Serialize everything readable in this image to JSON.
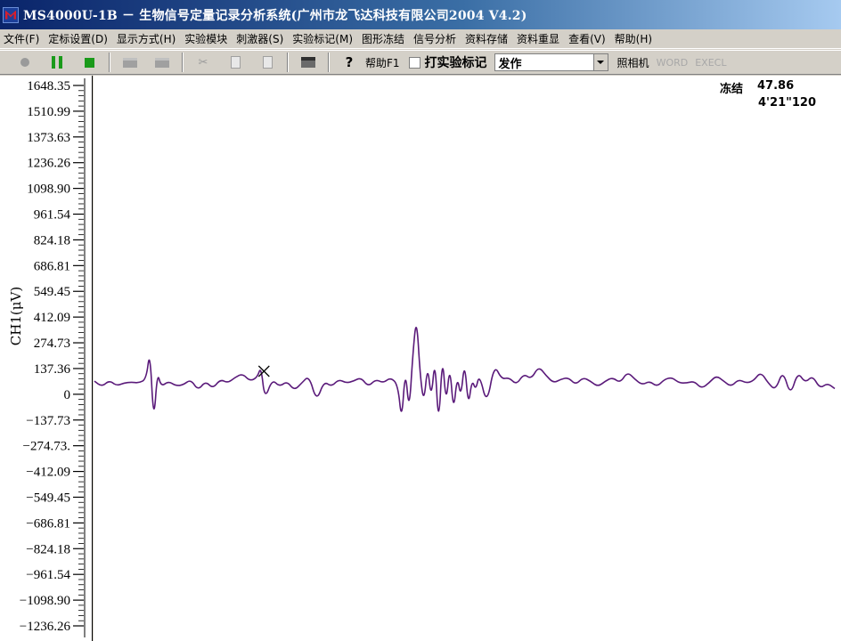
{
  "window": {
    "title": "MS4000U-1B － 生物信号定量记录分析系统(广州市龙飞达科技有限公司2004  V4.2)"
  },
  "menu": [
    "文件(F)",
    "定标设置(D)",
    "显示方式(H)",
    "实验模块",
    "刺激器(S)",
    "实验标记(M)",
    "图形冻结",
    "信号分析",
    "资料存储",
    "资料重显",
    "查看(V)",
    "帮助(H)"
  ],
  "toolbar": {
    "help_label": "帮助F1",
    "mark_label": "打实验标记",
    "event_value": "发作",
    "camera_label": "照相机",
    "word_label": "WORD",
    "excel_label": "EXECL"
  },
  "freeze": {
    "label": "冻结",
    "value": "47.86",
    "time": "4'21\"120"
  },
  "chart_data": {
    "type": "line",
    "title": "",
    "xlabel": "",
    "ylabel": "CH1(μV)",
    "y_ticks": [
      "1648.35",
      "1510.99",
      "1373.63",
      "1236.26",
      "1098.90",
      "961.54",
      "824.18",
      "686.81",
      "549.45",
      "412.09",
      "274.73",
      "137.36",
      "0",
      "−137.73",
      "−274.73.",
      "−412.09",
      "−549.45",
      "−686.81",
      "−824.18",
      "−961.54",
      "−1098.90",
      "−1236.26"
    ],
    "y_tick_values": [
      1648.35,
      1510.99,
      1373.63,
      1236.26,
      1098.9,
      961.54,
      824.18,
      686.81,
      549.45,
      412.09,
      274.73,
      137.36,
      0,
      -137.73,
      -274.73,
      -412.09,
      -549.45,
      -686.81,
      -824.18,
      -961.54,
      -1098.9,
      -1236.26
    ],
    "ylim": [
      -1236.26,
      1648.35
    ],
    "x_range": [
      0,
      1
    ],
    "line_color": "#5a1a7a",
    "cursor_x": 0.229,
    "x": [
      0.0,
      0.01,
      0.02,
      0.03,
      0.04,
      0.05,
      0.06,
      0.07,
      0.075,
      0.08,
      0.085,
      0.09,
      0.1,
      0.11,
      0.12,
      0.13,
      0.14,
      0.15,
      0.16,
      0.17,
      0.18,
      0.19,
      0.2,
      0.21,
      0.22,
      0.225,
      0.23,
      0.24,
      0.25,
      0.26,
      0.27,
      0.28,
      0.29,
      0.3,
      0.31,
      0.32,
      0.33,
      0.34,
      0.35,
      0.36,
      0.37,
      0.38,
      0.39,
      0.4,
      0.41,
      0.415,
      0.42,
      0.425,
      0.43,
      0.435,
      0.44,
      0.445,
      0.45,
      0.455,
      0.46,
      0.465,
      0.47,
      0.475,
      0.48,
      0.485,
      0.49,
      0.495,
      0.5,
      0.505,
      0.51,
      0.515,
      0.52,
      0.53,
      0.54,
      0.55,
      0.56,
      0.57,
      0.58,
      0.59,
      0.6,
      0.61,
      0.62,
      0.63,
      0.64,
      0.65,
      0.66,
      0.67,
      0.68,
      0.69,
      0.7,
      0.71,
      0.72,
      0.73,
      0.74,
      0.75,
      0.76,
      0.77,
      0.78,
      0.79,
      0.8,
      0.81,
      0.82,
      0.83,
      0.84,
      0.85,
      0.86,
      0.87,
      0.88,
      0.89,
      0.9,
      0.91,
      0.92,
      0.93,
      0.94,
      0.95,
      0.96,
      0.97,
      0.98,
      0.99,
      1.0
    ],
    "values": [
      70,
      40,
      75,
      45,
      60,
      65,
      60,
      80,
      240,
      -160,
      120,
      40,
      70,
      45,
      50,
      80,
      20,
      70,
      30,
      80,
      60,
      90,
      110,
      70,
      90,
      150,
      -30,
      80,
      40,
      70,
      20,
      60,
      100,
      -40,
      70,
      40,
      80,
      60,
      70,
      90,
      40,
      80,
      60,
      90,
      50,
      -150,
      140,
      -100,
      210,
      420,
      100,
      -50,
      160,
      -30,
      200,
      -190,
      220,
      -60,
      160,
      -100,
      100,
      -20,
      180,
      -70,
      80,
      20,
      110,
      -60,
      160,
      80,
      90,
      50,
      110,
      80,
      150,
      100,
      60,
      80,
      90,
      50,
      90,
      70,
      40,
      70,
      90,
      60,
      120,
      80,
      50,
      70,
      40,
      80,
      90,
      60,
      60,
      70,
      30,
      60,
      100,
      70,
      40,
      80,
      60,
      70,
      120,
      60,
      20,
      130,
      -10,
      120,
      60,
      100,
      30,
      60,
      30
    ]
  }
}
